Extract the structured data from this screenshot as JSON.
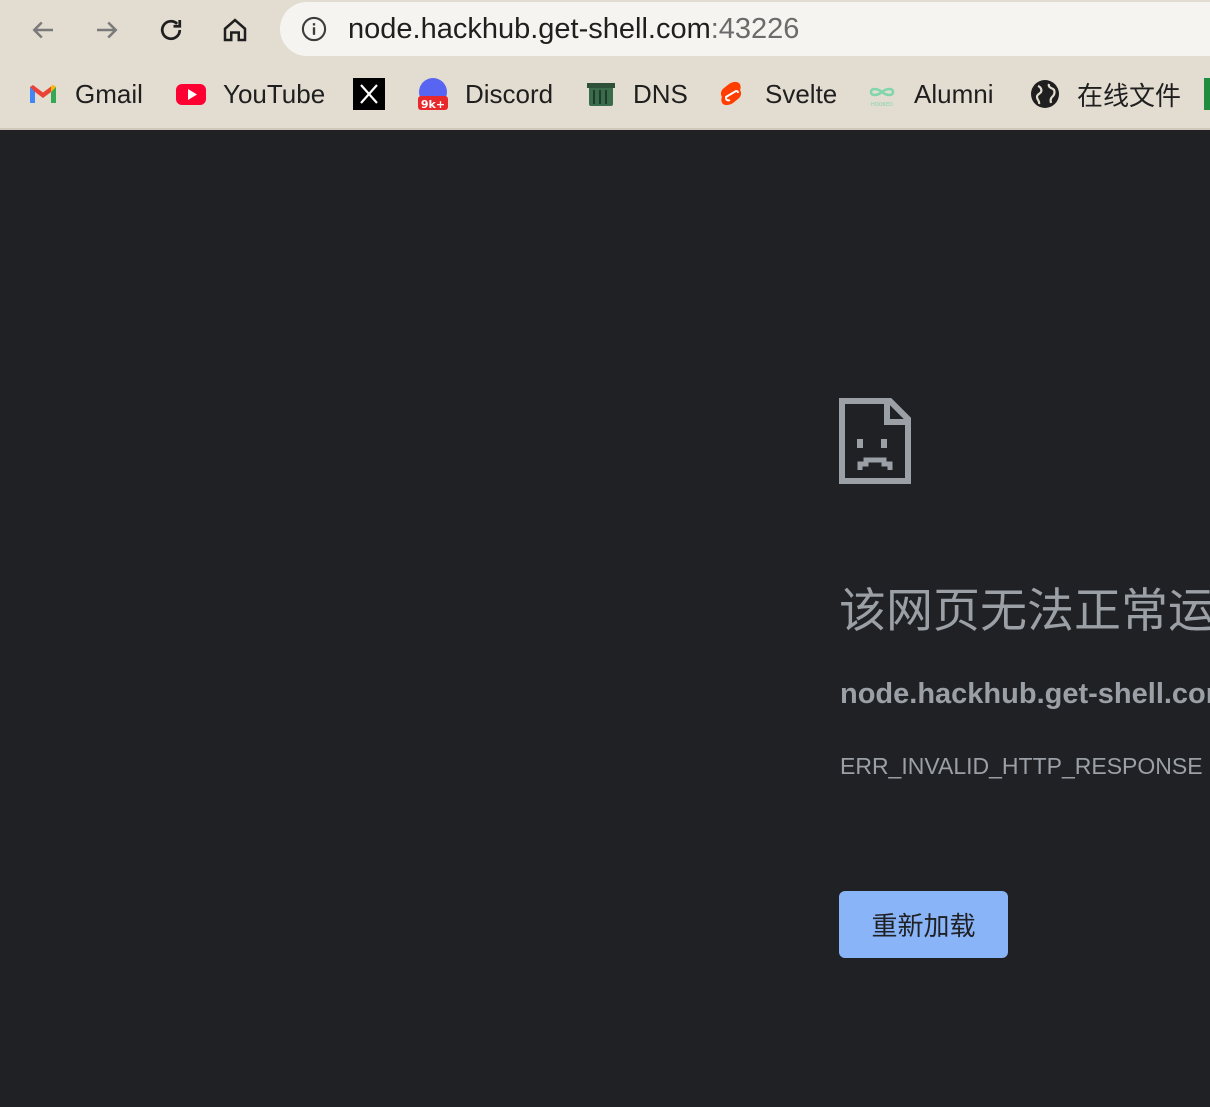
{
  "browser": {
    "url_host": "node.hackhub.get-shell.com",
    "url_port": ":43226"
  },
  "bookmarks": [
    {
      "label": "Gmail",
      "icon": "gmail-icon"
    },
    {
      "label": "YouTube",
      "icon": "youtube-icon"
    },
    {
      "label": "",
      "icon": "x-icon"
    },
    {
      "label": "Discord",
      "icon": "discord-icon"
    },
    {
      "label": "DNS",
      "icon": "dns-icon"
    },
    {
      "label": "Svelte",
      "icon": "svelte-icon"
    },
    {
      "label": "Alumni",
      "icon": "hooked-icon"
    },
    {
      "label": "在线文件",
      "icon": "globe-icon"
    }
  ],
  "error_page": {
    "title": "该网页无法正常运作",
    "host": "node.hackhub.get-shell.com",
    "code": "ERR_INVALID_HTTP_RESPONSE",
    "reload_label": "重新加载"
  },
  "colors": {
    "toolbar_bg": "#e3ddd1",
    "page_bg": "#202124",
    "text_muted": "#9aa0a6",
    "button_bg": "#8ab4f8"
  }
}
